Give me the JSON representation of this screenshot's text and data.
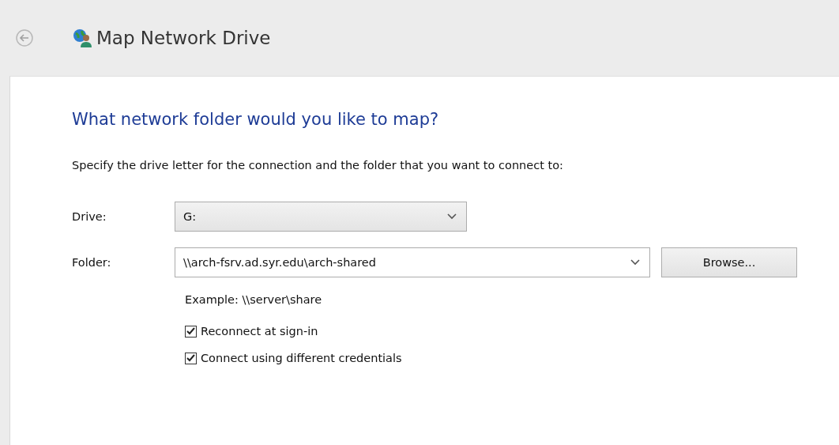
{
  "window": {
    "title": "Map Network Drive"
  },
  "heading": "What network folder would you like to map?",
  "instruction": "Specify the drive letter for the connection and the folder that you want to connect to:",
  "drive": {
    "label": "Drive:",
    "value": "G:"
  },
  "folder": {
    "label": "Folder:",
    "value": "\\\\arch-fsrv.ad.syr.edu\\arch-shared",
    "button": "Browse..."
  },
  "example": "Example: \\\\server\\share",
  "options": [
    {
      "label": "Reconnect at sign-in",
      "checked": true
    },
    {
      "label": "Connect using different credentials",
      "checked": true
    }
  ]
}
